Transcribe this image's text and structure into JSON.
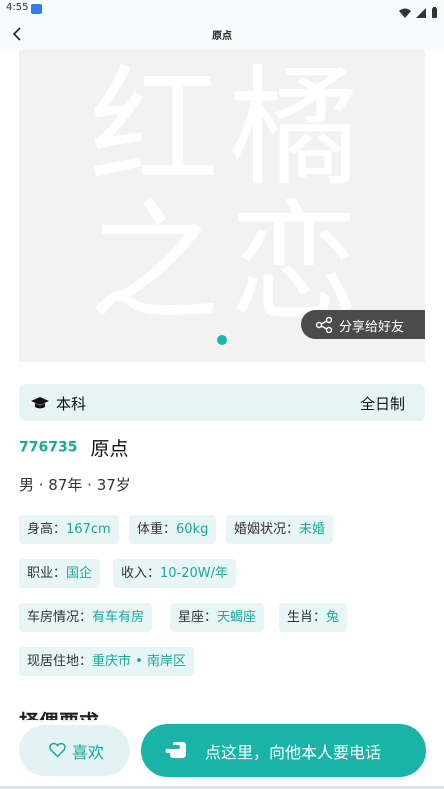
{
  "status_bar": {
    "time": "4:55"
  },
  "nav": {
    "title": "原点",
    "back_icon": "chevron-left-icon"
  },
  "photo": {
    "logo_text": [
      "红",
      "橘",
      "之",
      "恋"
    ],
    "share_label": "分享给好友",
    "carousel_total": 1,
    "carousel_index": 1
  },
  "education": {
    "degree": "本科",
    "mode": "全日制",
    "icon": "graduation-cap-icon"
  },
  "profile": {
    "id": "776735",
    "name": "原点",
    "basic": "男 · 87年 · 37岁"
  },
  "tags": [
    {
      "key": "身高：",
      "value": "167cm"
    },
    {
      "key": "体重：",
      "value": "60kg"
    },
    {
      "key": "婚姻状况：",
      "value": "未婚"
    },
    {
      "key": "职业：",
      "value": "国企"
    },
    {
      "key": "收入：",
      "value": "10-20W/年"
    },
    {
      "key": "车房情况：",
      "value": "有车有房"
    },
    {
      "key": "星座：",
      "value": "天蝎座"
    },
    {
      "key": "生肖：",
      "value": "兔"
    },
    {
      "key": "现居住地：",
      "value": "重庆市 • 南岸区"
    }
  ],
  "section_peek": "择偶要求",
  "actions": {
    "like_label": "喜欢",
    "call_label": "点这里，向他本人要电话"
  },
  "colors": {
    "accent": "#19b3a8",
    "tag_bg": "#e8f5f5",
    "share_bg": "#4b4b4b"
  }
}
